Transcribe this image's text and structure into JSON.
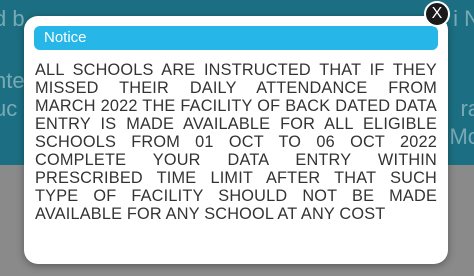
{
  "background": {
    "line_left_1": "d b",
    "line_right_1": "i N",
    "line_left_2": "nte",
    "line_right_2": "l",
    "line_left_3": "uc",
    "line_right_3": "ra",
    "line_left_4": "i",
    "line_right_4": "Mo"
  },
  "notice": {
    "title": "Notice",
    "message": "ALL SCHOOLS ARE INSTRUCTED THAT IF THEY MISSED THEIR DAILY ATTENDANCE FROM MARCH 2022 THE FACILITY OF BACK DATED DATA ENTRY IS MADE AVAILABLE FOR ALL ELIGIBLE SCHOOLS FROM 01 OCT TO 06 OCT 2022 COMPLETE YOUR DATA ENTRY WITHIN PRESCRIBED TIME LIMIT AFTER THAT SUCH TYPE OF FACILITY SHOULD NOT BE MADE AVAILABLE FOR ANY SCHOOL AT ANY COST",
    "close_label": "X"
  },
  "colors": {
    "header": "#26b6e8",
    "background_band": "#1c6f82",
    "overlay": "#8a8a8a",
    "close_button": "#1a1a1a"
  }
}
